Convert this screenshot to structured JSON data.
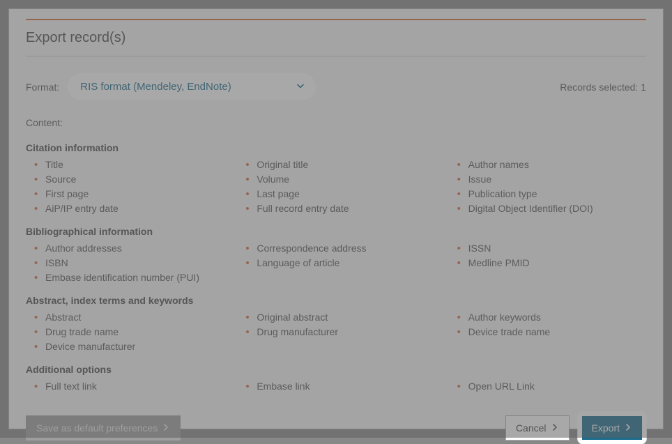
{
  "dialog": {
    "title": "Export record(s)",
    "format_label": "Format:",
    "format_value": "RIS format (Mendeley, EndNote)",
    "records_selected_label": "Records selected: 1",
    "content_label": "Content:",
    "footer": {
      "save_label": "Save as default preferences",
      "cancel_label": "Cancel",
      "export_label": "Export"
    }
  },
  "sections": [
    {
      "heading": "Citation information",
      "cols": [
        [
          "Title",
          "Source",
          "First page",
          "AiP/IP entry date"
        ],
        [
          "Original title",
          "Volume",
          "Last page",
          "Full record entry date"
        ],
        [
          "Author names",
          "Issue",
          "Publication type",
          "Digital Object Identifier (DOI)"
        ]
      ]
    },
    {
      "heading": "Bibliographical information",
      "cols": [
        [
          "Author addresses",
          "ISBN",
          "Embase identification number (PUI)"
        ],
        [
          "Correspondence address",
          "Language of article"
        ],
        [
          "ISSN",
          "Medline PMID"
        ]
      ]
    },
    {
      "heading": "Abstract, index terms and keywords",
      "cols": [
        [
          "Abstract",
          "Drug trade name",
          "Device manufacturer"
        ],
        [
          "Original abstract",
          "Drug manufacturer"
        ],
        [
          "Author keywords",
          "Device trade name"
        ]
      ]
    },
    {
      "heading": "Additional options",
      "cols": [
        [
          "Full text link"
        ],
        [
          "Embase link"
        ],
        [
          "Open URL Link"
        ]
      ]
    }
  ]
}
